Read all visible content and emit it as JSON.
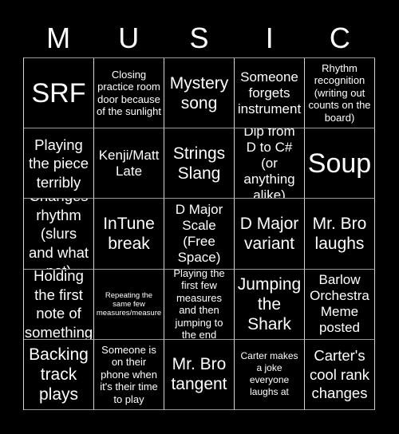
{
  "header": {
    "letters": [
      "M",
      "U",
      "S",
      "I",
      "C"
    ]
  },
  "board": {
    "rows": [
      [
        {
          "text": "SRF",
          "size": "xl"
        },
        {
          "text": "Closing practice room door because of the sunlight",
          "size": "sm"
        },
        {
          "text": "Mystery song",
          "size": "lg"
        },
        {
          "text": "Someone forgets instrument",
          "size": "md"
        },
        {
          "text": "Rhythm recognition (writing out counts on the board)",
          "size": "sm"
        }
      ],
      [
        {
          "text": "Playing the piece terribly",
          "size": "mdl"
        },
        {
          "text": "Kenji/Matt Late",
          "size": "md"
        },
        {
          "text": "Strings Slang",
          "size": "lg"
        },
        {
          "text": "Dip from D to C# (or anything alike)",
          "size": "md"
        },
        {
          "text": "Soup",
          "size": "xl"
        }
      ],
      [
        {
          "text": "Changes rhythm (slurs and what not)",
          "size": "mdl"
        },
        {
          "text": "InTune break",
          "size": "lg"
        },
        {
          "text": "D Major Scale (Free Space)",
          "size": "md"
        },
        {
          "text": "D Major variant",
          "size": "lg"
        },
        {
          "text": "Mr. Bro laughs",
          "size": "lg"
        }
      ],
      [
        {
          "text": "Holding the first note of something",
          "size": "mdl"
        },
        {
          "text": "Repeating the same few measures/measure",
          "size": "xs"
        },
        {
          "text": "Playing the first few measures and then jumping to the end",
          "size": "sm"
        },
        {
          "text": "Jumping the Shark",
          "size": "lg"
        },
        {
          "text": "Barlow Orchestra Meme posted",
          "size": "md"
        }
      ],
      [
        {
          "text": "Backing track plays",
          "size": "lg"
        },
        {
          "text": "Someone is on their phone when it's their time to play",
          "size": "sm"
        },
        {
          "text": "Mr. Bro tangent",
          "size": "lg"
        },
        {
          "text": "Carter makes a joke everyone laughs at",
          "size": "sm2"
        },
        {
          "text": "Carter's cool rank changes",
          "size": "mdl"
        }
      ]
    ]
  },
  "colors": {
    "background": "#000000",
    "text": "#ffffff",
    "grid_line": "#d8d8d8"
  }
}
